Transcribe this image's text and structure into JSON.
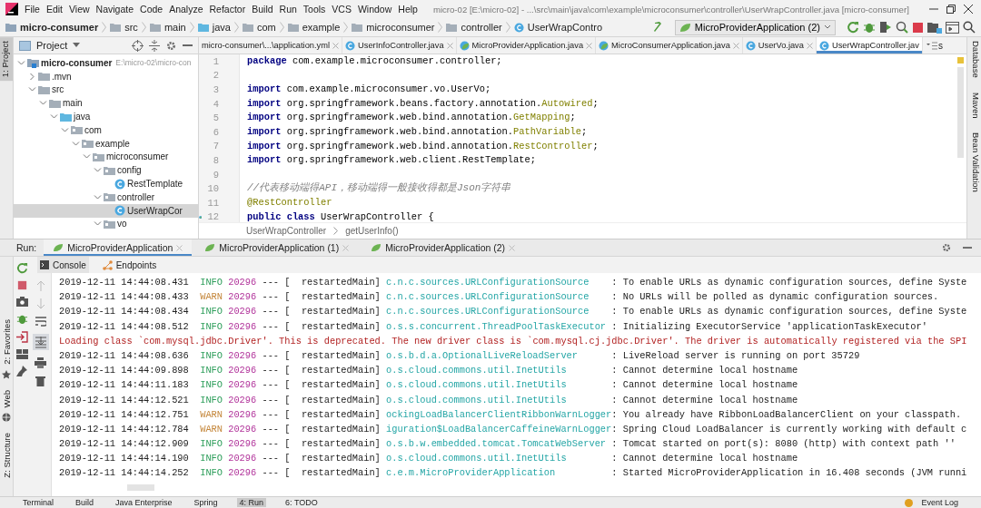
{
  "window": {
    "title": "micro-02 [E:\\micro-02] - ...\\src\\main\\java\\com\\example\\microconsumer\\controller\\UserWrapController.java [micro-consumer]"
  },
  "menu": [
    "File",
    "Edit",
    "View",
    "Navigate",
    "Code",
    "Analyze",
    "Refactor",
    "Build",
    "Run",
    "Tools",
    "VCS",
    "Window",
    "Help"
  ],
  "breadcrumb": [
    {
      "label": "micro-consumer",
      "kind": "module"
    },
    {
      "label": "src",
      "kind": "folder"
    },
    {
      "label": "main",
      "kind": "folder"
    },
    {
      "label": "java",
      "kind": "source"
    },
    {
      "label": "com",
      "kind": "package"
    },
    {
      "label": "example",
      "kind": "package"
    },
    {
      "label": "microconsumer",
      "kind": "package"
    },
    {
      "label": "controller",
      "kind": "package"
    },
    {
      "label": "UserWrapContro",
      "kind": "class"
    }
  ],
  "run_config": {
    "label": "MicroProviderApplication (2)"
  },
  "project": {
    "label": "Project",
    "tree": [
      {
        "name": "micro-consumer",
        "kind": "module",
        "path": "E:\\micro-02\\micro-con",
        "expanded": true,
        "selected": false,
        "children": [
          {
            "name": ".mvn",
            "kind": "folder",
            "expanded": false,
            "selected": false
          },
          {
            "name": "src",
            "kind": "folder",
            "expanded": true,
            "selected": false,
            "children": [
              {
                "name": "main",
                "kind": "folder",
                "expanded": true,
                "selected": false,
                "children": [
                  {
                    "name": "java",
                    "kind": "source",
                    "expanded": true,
                    "selected": false,
                    "children": [
                      {
                        "name": "com",
                        "kind": "package",
                        "expanded": true,
                        "selected": false,
                        "children": [
                          {
                            "name": "example",
                            "kind": "package",
                            "expanded": true,
                            "selected": false,
                            "children": [
                              {
                                "name": "microconsumer",
                                "kind": "package",
                                "expanded": true,
                                "selected": false,
                                "children": [
                                  {
                                    "name": "config",
                                    "kind": "package",
                                    "expanded": true,
                                    "selected": false,
                                    "children": [
                                      {
                                        "name": "RestTemplate",
                                        "kind": "class",
                                        "selected": false
                                      }
                                    ]
                                  },
                                  {
                                    "name": "controller",
                                    "kind": "package",
                                    "expanded": true,
                                    "selected": false,
                                    "children": [
                                      {
                                        "name": "UserWrapCor",
                                        "kind": "class",
                                        "selected": true
                                      }
                                    ]
                                  },
                                  {
                                    "name": "vo",
                                    "kind": "package",
                                    "expanded": true,
                                    "selected": false
                                  }
                                ]
                              }
                            ]
                          }
                        ]
                      }
                    ]
                  }
                ]
              }
            ]
          }
        ]
      }
    ]
  },
  "editor_tabs": [
    {
      "label": "micro-consumer\\...\\application.yml",
      "kind": "yml",
      "selected": false
    },
    {
      "label": "UserInfoController.java",
      "kind": "class",
      "selected": false
    },
    {
      "label": "MicroProviderApplication.java",
      "kind": "app",
      "selected": false
    },
    {
      "label": "MicroConsumerApplication.java",
      "kind": "app",
      "selected": false
    },
    {
      "label": "UserVo.java",
      "kind": "class",
      "selected": false
    },
    {
      "label": "UserWrapController.jav",
      "kind": "class",
      "selected": true
    }
  ],
  "tabs_overflow": "s",
  "editor": {
    "lines": [
      {
        "n": "1",
        "segs": [
          {
            "t": "package ",
            "kind": "keyword"
          },
          {
            "t": "com.example.microconsumer.controller;",
            "kind": "plain"
          }
        ]
      },
      {
        "n": "2"
      },
      {
        "n": "3",
        "segs": [
          {
            "t": "import ",
            "kind": "keyword"
          },
          {
            "t": "com.example.microconsumer.vo.UserVo;",
            "kind": "plain"
          }
        ]
      },
      {
        "n": "4",
        "segs": [
          {
            "t": "import ",
            "kind": "keyword"
          },
          {
            "t": "org.springframework.beans.factory.annotation.",
            "kind": "plain"
          },
          {
            "t": "Autowired",
            "kind": "annotation"
          },
          {
            "t": ";",
            "kind": "plain"
          }
        ]
      },
      {
        "n": "5",
        "segs": [
          {
            "t": "import ",
            "kind": "keyword"
          },
          {
            "t": "org.springframework.web.bind.annotation.",
            "kind": "plain"
          },
          {
            "t": "GetMapping",
            "kind": "annotation"
          },
          {
            "t": ";",
            "kind": "plain"
          }
        ]
      },
      {
        "n": "6",
        "segs": [
          {
            "t": "import ",
            "kind": "keyword"
          },
          {
            "t": "org.springframework.web.bind.annotation.",
            "kind": "plain"
          },
          {
            "t": "PathVariable",
            "kind": "annotation"
          },
          {
            "t": ";",
            "kind": "plain"
          }
        ]
      },
      {
        "n": "7",
        "segs": [
          {
            "t": "import ",
            "kind": "keyword"
          },
          {
            "t": "org.springframework.web.bind.annotation.",
            "kind": "plain"
          },
          {
            "t": "RestController",
            "kind": "annotation"
          },
          {
            "t": ";",
            "kind": "plain"
          }
        ]
      },
      {
        "n": "8",
        "segs": [
          {
            "t": "import ",
            "kind": "keyword"
          },
          {
            "t": "org.springframework.web.client.RestTemplate;",
            "kind": "plain"
          }
        ]
      },
      {
        "n": "9"
      },
      {
        "n": "10",
        "segs": [
          {
            "t": "//代表移动端得API，移动端得一般接收得都是Json字符串",
            "kind": "comment"
          }
        ]
      },
      {
        "n": "11",
        "segs": [
          {
            "t": "@RestController",
            "kind": "annotation"
          }
        ]
      },
      {
        "n": "12",
        "segs": [
          {
            "t": "public class ",
            "kind": "keyword"
          },
          {
            "t": "UserWrapController {",
            "kind": "plain"
          }
        ]
      }
    ],
    "breadcrumb": [
      "UserWrapController",
      "getUserInfo()"
    ]
  },
  "right_tools": [
    "Database",
    "Maven",
    "Bean Validation"
  ],
  "left_tools": [
    "1: Project"
  ],
  "left_tools_bottom": [
    {
      "label": "2: Favorites",
      "kind": "star"
    },
    {
      "label": "Web",
      "kind": "globe"
    },
    {
      "label": "Z: Structure",
      "kind": "structure"
    }
  ],
  "run": {
    "label": "Run:",
    "tabs": [
      {
        "label": "MicroProviderApplication",
        "selected": true
      },
      {
        "label": "MicroProviderApplication (1)",
        "selected": false
      },
      {
        "label": "MicroProviderApplication (2)",
        "selected": false
      }
    ],
    "subtabs": [
      {
        "label": "Console",
        "selected": true
      },
      {
        "label": "Endpoints",
        "selected": false
      }
    ],
    "log": [
      {
        "kind": "log",
        "time": "2019-12-11 14:44:08.431",
        "level": "INFO",
        "pid": "20296",
        "thread": "--- [  restartedMain]",
        "logger": "c.n.c.sources.URLConfigurationSource",
        "message": ": To enable URLs as dynamic configuration sources, define Syste"
      },
      {
        "kind": "log",
        "time": "2019-12-11 14:44:08.433",
        "level": "WARN",
        "pid": "20296",
        "thread": "--- [  restartedMain]",
        "logger": "c.n.c.sources.URLConfigurationSource",
        "message": ": No URLs will be polled as dynamic configuration sources."
      },
      {
        "kind": "log",
        "time": "2019-12-11 14:44:08.434",
        "level": "INFO",
        "pid": "20296",
        "thread": "--- [  restartedMain]",
        "logger": "c.n.c.sources.URLConfigurationSource",
        "message": ": To enable URLs as dynamic configuration sources, define Syste"
      },
      {
        "kind": "log",
        "time": "2019-12-11 14:44:08.512",
        "level": "INFO",
        "pid": "20296",
        "thread": "--- [  restartedMain]",
        "logger": "o.s.s.concurrent.ThreadPoolTaskExecutor",
        "message": ": Initializing ExecutorService 'applicationTaskExecutor'"
      },
      {
        "kind": "error",
        "text": "Loading class `com.mysql.jdbc.Driver'. This is deprecated. The new driver class is `com.mysql.cj.jdbc.Driver'. The driver is automatically registered via the SPI"
      },
      {
        "kind": "log",
        "time": "2019-12-11 14:44:08.636",
        "level": "INFO",
        "pid": "20296",
        "thread": "--- [  restartedMain]",
        "logger": "o.s.b.d.a.OptionalLiveReloadServer",
        "message": ": LiveReload server is running on port 35729"
      },
      {
        "kind": "log",
        "time": "2019-12-11 14:44:09.898",
        "level": "INFO",
        "pid": "20296",
        "thread": "--- [  restartedMain]",
        "logger": "o.s.cloud.commons.util.InetUtils",
        "message": ": Cannot determine local hostname"
      },
      {
        "kind": "log",
        "time": "2019-12-11 14:44:11.183",
        "level": "INFO",
        "pid": "20296",
        "thread": "--- [  restartedMain]",
        "logger": "o.s.cloud.commons.util.InetUtils",
        "message": ": Cannot determine local hostname"
      },
      {
        "kind": "log",
        "time": "2019-12-11 14:44:12.521",
        "level": "INFO",
        "pid": "20296",
        "thread": "--- [  restartedMain]",
        "logger": "o.s.cloud.commons.util.InetUtils",
        "message": ": Cannot determine local hostname"
      },
      {
        "kind": "log",
        "time": "2019-12-11 14:44:12.751",
        "level": "WARN",
        "pid": "20296",
        "thread": "--- [  restartedMain]",
        "logger": "ockingLoadBalancerClientRibbonWarnLogger",
        "message": ": You already have RibbonLoadBalancerClient on your classpath."
      },
      {
        "kind": "log",
        "time": "2019-12-11 14:44:12.784",
        "level": "WARN",
        "pid": "20296",
        "thread": "--- [  restartedMain]",
        "logger": "iguration$LoadBalancerCaffeineWarnLogger",
        "message": ": Spring Cloud LoadBalancer is currently working with default c"
      },
      {
        "kind": "log",
        "time": "2019-12-11 14:44:12.909",
        "level": "INFO",
        "pid": "20296",
        "thread": "--- [  restartedMain]",
        "logger": "o.s.b.w.embedded.tomcat.TomcatWebServer",
        "message": ": Tomcat started on port(s): 8080 (http) with context path ''"
      },
      {
        "kind": "log",
        "time": "2019-12-11 14:44:14.190",
        "level": "INFO",
        "pid": "20296",
        "thread": "--- [  restartedMain]",
        "logger": "o.s.cloud.commons.util.InetUtils",
        "message": ": Cannot determine local hostname"
      },
      {
        "kind": "log",
        "time": "2019-12-11 14:44:14.252",
        "level": "INFO",
        "pid": "20296",
        "thread": "--- [  restartedMain]",
        "logger": "c.e.m.MicroProviderApplication",
        "message": ": Started MicroProviderApplication in 16.408 seconds (JVM runni"
      }
    ]
  },
  "bottom_tools": [
    {
      "label": "Terminal",
      "selected": false
    },
    {
      "label": "Build",
      "selected": false
    },
    {
      "label": "Java Enterprise",
      "selected": false
    },
    {
      "label": "Spring",
      "selected": false
    },
    {
      "label": "4: Run",
      "selected": true
    },
    {
      "label": "6: TODO",
      "selected": false
    }
  ],
  "event_log": "Event Log"
}
